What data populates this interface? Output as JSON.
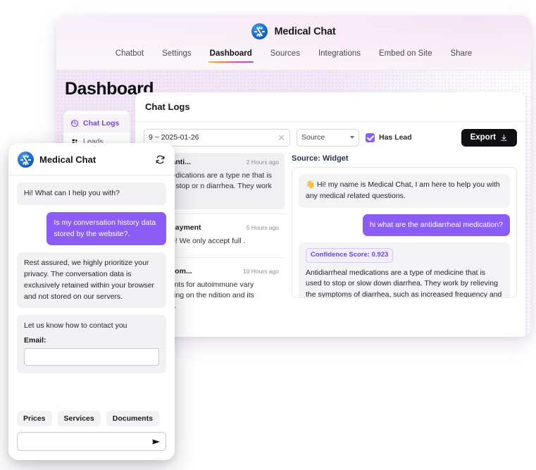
{
  "brand": {
    "name": "Medical Chat",
    "logo_icon": "snowflake-logo-icon"
  },
  "nav": {
    "tabs": [
      {
        "label": "Chatbot",
        "active": false
      },
      {
        "label": "Settings",
        "active": false
      },
      {
        "label": "Dashboard",
        "active": true
      },
      {
        "label": "Sources",
        "active": false
      },
      {
        "label": "Integrations",
        "active": false
      },
      {
        "label": "Embed on Site",
        "active": false
      },
      {
        "label": "Share",
        "active": false
      }
    ]
  },
  "page": {
    "title": "Dashboard"
  },
  "sidebar": {
    "items": [
      {
        "label": "Chat Logs",
        "icon": "clock-history-icon",
        "active": true
      },
      {
        "label": "Leads",
        "icon": "people-icon",
        "active": false
      }
    ]
  },
  "panel": {
    "title": "Chat Logs",
    "toolbar": {
      "date_range": "9 ~ 2025-01-26",
      "clear_icon": "close-icon",
      "source_select": "Source",
      "source_caret_icon": "chevron-down-icon",
      "has_lead_label": "Has Lead",
      "has_lead_checked": true,
      "export_label": "Export",
      "export_icon": "download-icon"
    },
    "logs": [
      {
        "question": "re the anti...",
        "time": "2 Hours ago",
        "answer": "heal medications are a type\nne that is used to stop or\nn diarrhea. They work by...",
        "selected": true
      },
      {
        "question": "ccept payment",
        "time": "5 Hours ago",
        "answer": "ately no! We only accept full\n.",
        "selected": false
      },
      {
        "question": "some com...",
        "time": "10 Hours ago",
        "answer": "treatments for autoimmune\nvary depending on the\nndition and its severity.",
        "selected": false
      }
    ],
    "detail": {
      "source_label": "Source: Widget",
      "messages": [
        {
          "role": "bot",
          "text": "👋 Hi! my name is Medical Chat, I am here to help you with any medical related questions."
        },
        {
          "role": "user",
          "text": "hi what are the antidiarrheal medication?"
        },
        {
          "role": "bot",
          "confidence": "Confidence Score: 0.923",
          "text": "Antidiarrheal medications are a type of medicine that is used to stop or slow down diarrhea. They work by relieving the symptoms of diarrhea, such as increased frequency and urgency when passing stools. However, it is important to note that antidiarrheals do not eliminate the underlying cause of diarrhea. Once you stop taking an"
        }
      ]
    }
  },
  "widget": {
    "title": "Medical Chat",
    "refresh_icon": "refresh-icon",
    "messages": [
      {
        "role": "bot",
        "text": "Hi! What can I help you with?"
      },
      {
        "role": "user",
        "text": "Is my conversation history data stored by the website?."
      },
      {
        "role": "bot",
        "text": "Rest assured, we highly prioritize your privacy. The conversation data is exclusively retained within your browser and not stored on our servers."
      }
    ],
    "lead_form": {
      "title": "Let us know how to contact you",
      "email_label": "Email:",
      "email_value": "",
      "email_placeholder": ""
    },
    "suggestions": [
      {
        "label": "Prices"
      },
      {
        "label": "Services"
      },
      {
        "label": "Documents"
      }
    ],
    "composer": {
      "value": "",
      "placeholder": "",
      "send_icon": "send-icon"
    }
  },
  "colors": {
    "accent_purple": "#8b5cf6",
    "active_tab": "#7c3aed",
    "export_bg": "#111115",
    "logo_blue": "#1565c0"
  }
}
